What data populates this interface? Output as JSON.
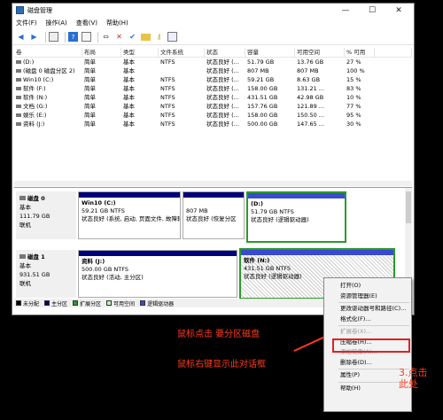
{
  "window": {
    "title": "磁盘管理"
  },
  "menu": [
    "文件(F)",
    "操作(A)",
    "查看(V)",
    "帮助(H)"
  ],
  "volume_table": {
    "headers": [
      "卷",
      "布局",
      "类型",
      "文件系统",
      "状态",
      "容量",
      "可用空间",
      "% 可用"
    ],
    "rows": [
      [
        "(D:)",
        "简单",
        "基本",
        "NTFS",
        "状态良好 (...",
        "51.79 GB",
        "13.76 GB",
        "27 %"
      ],
      [
        "(磁盘 0 磁盘分区 2)",
        "简单",
        "基本",
        "",
        "状态良好 (...",
        "807 MB",
        "807 MB",
        "100 %"
      ],
      [
        "Win10 (C:)",
        "简单",
        "基本",
        "NTFS",
        "状态良好 (...",
        "59.21 GB",
        "8.63 GB",
        "15 %"
      ],
      [
        "软件 (F:)",
        "简单",
        "基本",
        "NTFS",
        "状态良好 (...",
        "158.00 GB",
        "131.21 ...",
        "83 %"
      ],
      [
        "软件 (N:)",
        "简单",
        "基本",
        "NTFS",
        "状态良好 (...",
        "431.51 GB",
        "42.98 GB",
        "10 %"
      ],
      [
        "文档 (G:)",
        "简单",
        "基本",
        "NTFS",
        "状态良好 (...",
        "157.76 GB",
        "121.89 ...",
        "77 %"
      ],
      [
        "娱乐 (E:)",
        "简单",
        "基本",
        "NTFS",
        "状态良好 (...",
        "158.00 GB",
        "150.50 ...",
        "95 %"
      ],
      [
        "资料 (J:)",
        "简单",
        "基本",
        "NTFS",
        "状态良好 (...",
        "500.00 GB",
        "147.65 ...",
        "30 %"
      ]
    ]
  },
  "disks": [
    {
      "name": "磁盘 0",
      "type": "基本",
      "size": "111.79 GB",
      "status": "联机",
      "partitions": [
        {
          "name": "Win10 (C:)",
          "size": "59.21 GB NTFS",
          "status": "状态良好 (系统, 启动, 页面文件, 故障转储"
        },
        {
          "name": "",
          "size": "807 MB",
          "status": "状态良好 (恢复分区"
        },
        {
          "name": "(D:)",
          "size": "51.79 GB NTFS",
          "status": "状态良好 (逻辑驱动器)"
        }
      ]
    },
    {
      "name": "磁盘 1",
      "type": "基本",
      "size": "931.51 GB",
      "status": "联机",
      "partitions": [
        {
          "name": "资料 (J:)",
          "size": "500.00 GB NTFS",
          "status": "状态良好 (活动, 主分区)"
        },
        {
          "name": "软件 (N:)",
          "size": "431.51 GB NTFS",
          "status": "状态良好 (逻辑驱动器)"
        }
      ]
    }
  ],
  "legend": [
    {
      "label": "未分配",
      "color": "#000000"
    },
    {
      "label": "主分区",
      "color": "#00007a"
    },
    {
      "label": "扩展分区",
      "color": "#2a9a2a"
    },
    {
      "label": "可用空间",
      "color": "#b9f2b9"
    },
    {
      "label": "逻辑驱动器",
      "color": "#3a4ad0"
    }
  ],
  "context_menu": [
    {
      "label": "打开(O)",
      "enabled": true
    },
    {
      "label": "资源管理器(E)",
      "enabled": true
    },
    {
      "label": "更改驱动器号和路径(C)...",
      "enabled": true
    },
    {
      "label": "格式化(F)...",
      "enabled": true
    },
    {
      "label": "扩展卷(X)...",
      "enabled": false
    },
    {
      "label": "压缩卷(H)...",
      "enabled": true
    },
    {
      "label": "添加镜像(A)...",
      "enabled": false
    },
    {
      "label": "删除卷(D)...",
      "enabled": true
    },
    {
      "label": "属性(P)",
      "enabled": true
    },
    {
      "label": "帮助(H)",
      "enabled": true
    }
  ],
  "annotations": {
    "note1": "鼠标点击  要分区磁盘",
    "note2": "鼠标右键显示此对话框",
    "note3_line1": "3.点击",
    "note3_line2": "此处"
  },
  "colors": {
    "highlight": "#e02020",
    "annotation": "#ff3b1e",
    "selected_border": "#2a9a2a"
  }
}
